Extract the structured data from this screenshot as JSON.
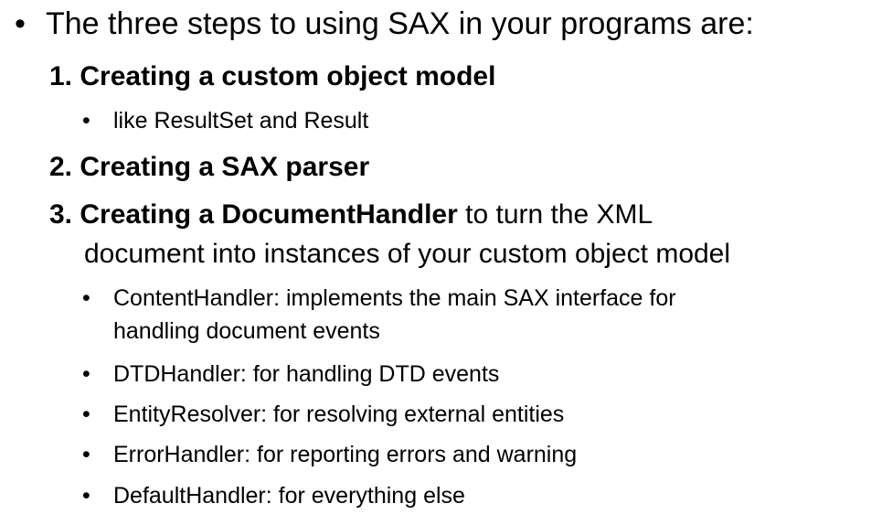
{
  "bullet_glyph": "•",
  "intro": "The three steps to using SAX in your programs are:",
  "steps": [
    {
      "number": "1.",
      "bold_text": "Creating a custom object model",
      "sub_items": [
        "like ResultSet and Result"
      ]
    },
    {
      "number": "2.",
      "bold_text": "Creating a SAX parser",
      "sub_items": []
    },
    {
      "number": "3.",
      "bold_text": "Creating a DocumentHandler",
      "rest_text": "to turn the XML",
      "rest_text_cont": "document into instances of your custom object model",
      "sub_items": [
        "ContentHandler: implements the main SAX interface for",
        "handling document events",
        "DTDHandler: for handling DTD events",
        "EntityResolver: for resolving external entities",
        "ErrorHandler: for reporting errors and warning",
        "DefaultHandler: for everything else"
      ]
    }
  ]
}
